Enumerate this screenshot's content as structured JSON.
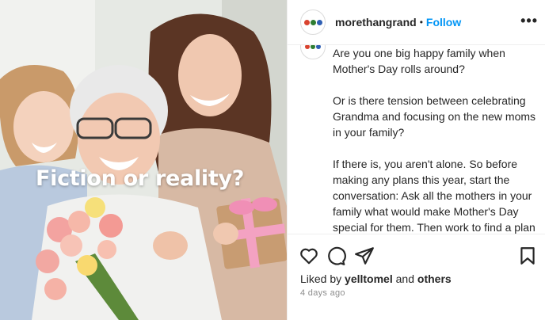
{
  "media": {
    "overlay_text": "Fiction or reality?"
  },
  "header": {
    "username": "morethangrand",
    "separator": "•",
    "follow_label": "Follow",
    "more_label": "•••",
    "avatar_colors": [
      "#d9432f",
      "#2e7d32",
      "#2f5fb3"
    ]
  },
  "caption": {
    "paragraphs": [
      "Are you one big happy family when Mother's Day rolls around?",
      "Or is there tension between celebrating Grandma and focusing on the new moms in your family?",
      "If there is, you aren't alone. So before making any plans this year, start the conversation: Ask all the mothers in your family what would make Mother's Day special for them. Then work to find a plan that makes everyone feel loved and"
    ]
  },
  "actions": {
    "like_icon": "heart-icon",
    "comment_icon": "comment-icon",
    "share_icon": "share-icon",
    "save_icon": "bookmark-icon"
  },
  "likes": {
    "prefix": "Liked by",
    "user": "yelltomel",
    "and": "and",
    "others": "others"
  },
  "time_ago": "4 days ago",
  "colors": {
    "follow": "#0095f6",
    "text": "#262626",
    "muted": "#8e8e8e"
  }
}
